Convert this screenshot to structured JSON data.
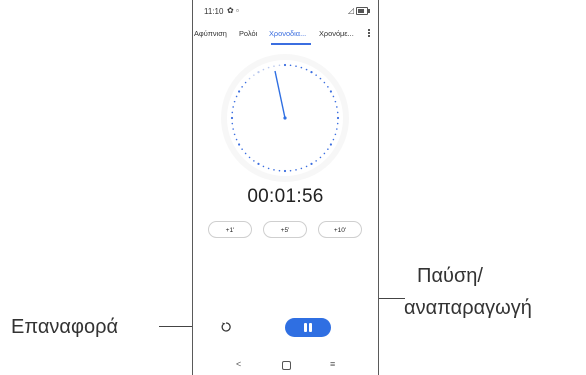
{
  "status_bar": {
    "time": "11:10",
    "settings_glyph": "✿",
    "image_glyph": "▫",
    "signal_glyph": "◿",
    "battery_level": 0.7
  },
  "tabs": [
    {
      "label": "Αφύπνιση",
      "active": false
    },
    {
      "label": "Ρολόι",
      "active": false
    },
    {
      "label": "Χρονοδια...",
      "active": true
    },
    {
      "label": "Χρονόμε...",
      "active": false
    }
  ],
  "colors": {
    "accent": "#2f6fe2",
    "dial_dots": "#3b6ee0"
  },
  "stopwatch": {
    "time": "00:01:56",
    "lap_buttons": [
      "+1'",
      "+5'",
      "+10'"
    ]
  },
  "controls": {
    "reset_icon": "reset-icon",
    "pause_icon": "pause-icon"
  },
  "nav": {
    "back": "<",
    "home": "home-icon",
    "recents": "≡"
  },
  "callouts": {
    "reset_label": "Επαναφορά",
    "pause_line1": "Παύση/",
    "pause_line2": "αναπαραγωγή"
  }
}
